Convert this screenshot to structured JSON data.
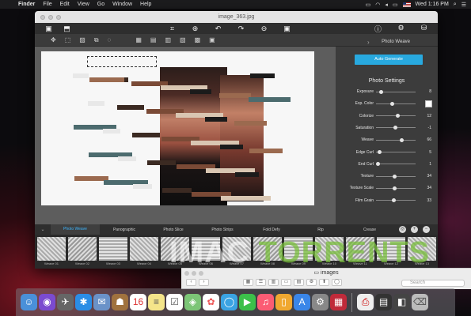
{
  "menubar": {
    "apple_icon": "apple-icon",
    "items": [
      "Finder",
      "File",
      "Edit",
      "View",
      "Go",
      "Window",
      "Help"
    ],
    "clock": "Wed 1:16 PM"
  },
  "window": {
    "title": "image_363.jpg",
    "panel_title": "Photo Weave"
  },
  "panel": {
    "auto_generate": "Auto Generate",
    "section_title": "Photo Settings",
    "settings": [
      {
        "label": "Exposure",
        "value": "8",
        "pos": 0.08
      },
      {
        "label": "Exp. Color",
        "value": "",
        "pos": 0.4,
        "swatch": "#ffffff"
      },
      {
        "label": "Colorize",
        "value": "12",
        "pos": 0.55
      },
      {
        "label": "Saturation",
        "value": "-1",
        "pos": 0.48
      },
      {
        "label": "Weave",
        "value": "66",
        "pos": 0.66
      },
      {
        "label": "Edge Curl",
        "value": "5",
        "pos": 0.05
      },
      {
        "label": "End Curl",
        "value": "1",
        "pos": 0.01
      },
      {
        "label": "Texture",
        "value": "34",
        "pos": 0.45
      },
      {
        "label": "Texture Scale",
        "value": "34",
        "pos": 0.45
      },
      {
        "label": "Film Grain",
        "value": "33",
        "pos": 0.44
      }
    ]
  },
  "tabs": [
    "Photo Weave",
    "Panographic",
    "Photo Slice",
    "Photo Strips",
    "Fold Defy",
    "Rip",
    "Crease"
  ],
  "thumbs": [
    "Weave 01",
    "Weave 02",
    "Weave 03",
    "Weave 04",
    "Weave 05",
    "Weave 06",
    "Weave 07",
    "Weave 08",
    "Weave 09",
    "Weave 10",
    "Weave 11",
    "Weave 12",
    "Weave 13"
  ],
  "watermark": {
    "part1": "IMAC",
    "part2": "TORRENTS"
  },
  "finder": {
    "title": "images",
    "search_placeholder": "Search"
  },
  "colors": {
    "accent": "#28a9df",
    "tab_active": "#3db6ff"
  }
}
